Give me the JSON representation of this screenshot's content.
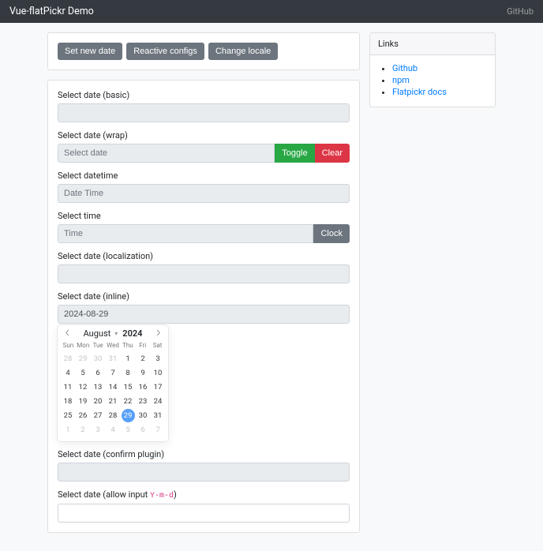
{
  "nav": {
    "brand": "Vue-flatPickr Demo",
    "github": "GitHub"
  },
  "buttons": {
    "set_new": "Set new date",
    "reactive": "Reactive configs",
    "locale": "Change locale",
    "toggle": "Toggle",
    "clear": "Clear",
    "clock": "Clock"
  },
  "labels": {
    "basic": "Select date (basic)",
    "wrap": "Select date (wrap)",
    "datetime": "Select datetime",
    "time": "Select time",
    "localization": "Select date (localization)",
    "inline": "Select date (inline)",
    "confirm": "Select date (confirm plugin)",
    "allow_pre": "Select date (allow input ",
    "allow_code": "Y-m-d",
    "allow_post": ")"
  },
  "placeholders": {
    "wrap": "Select date",
    "datetime": "Date Time",
    "time": "Time"
  },
  "values": {
    "inline": "2024-08-29"
  },
  "calendar": {
    "month": "August",
    "year": "2024",
    "weekdays": [
      "Sun",
      "Mon",
      "Tue",
      "Wed",
      "Thu",
      "Fri",
      "Sat"
    ],
    "prev_days": [
      "28",
      "29",
      "30",
      "31"
    ],
    "cur_days": [
      "1",
      "2",
      "3",
      "4",
      "5",
      "6",
      "7",
      "8",
      "9",
      "10",
      "11",
      "12",
      "13",
      "14",
      "15",
      "16",
      "17",
      "18",
      "19",
      "20",
      "21",
      "22",
      "23",
      "24",
      "25",
      "26",
      "27",
      "28",
      "29",
      "30",
      "31"
    ],
    "next_days": [
      "1",
      "2",
      "3",
      "4",
      "5",
      "6",
      "7"
    ],
    "selected": "29"
  },
  "links": {
    "title": "Links",
    "items": [
      "Github",
      "npm",
      "Flatpickr docs"
    ]
  }
}
